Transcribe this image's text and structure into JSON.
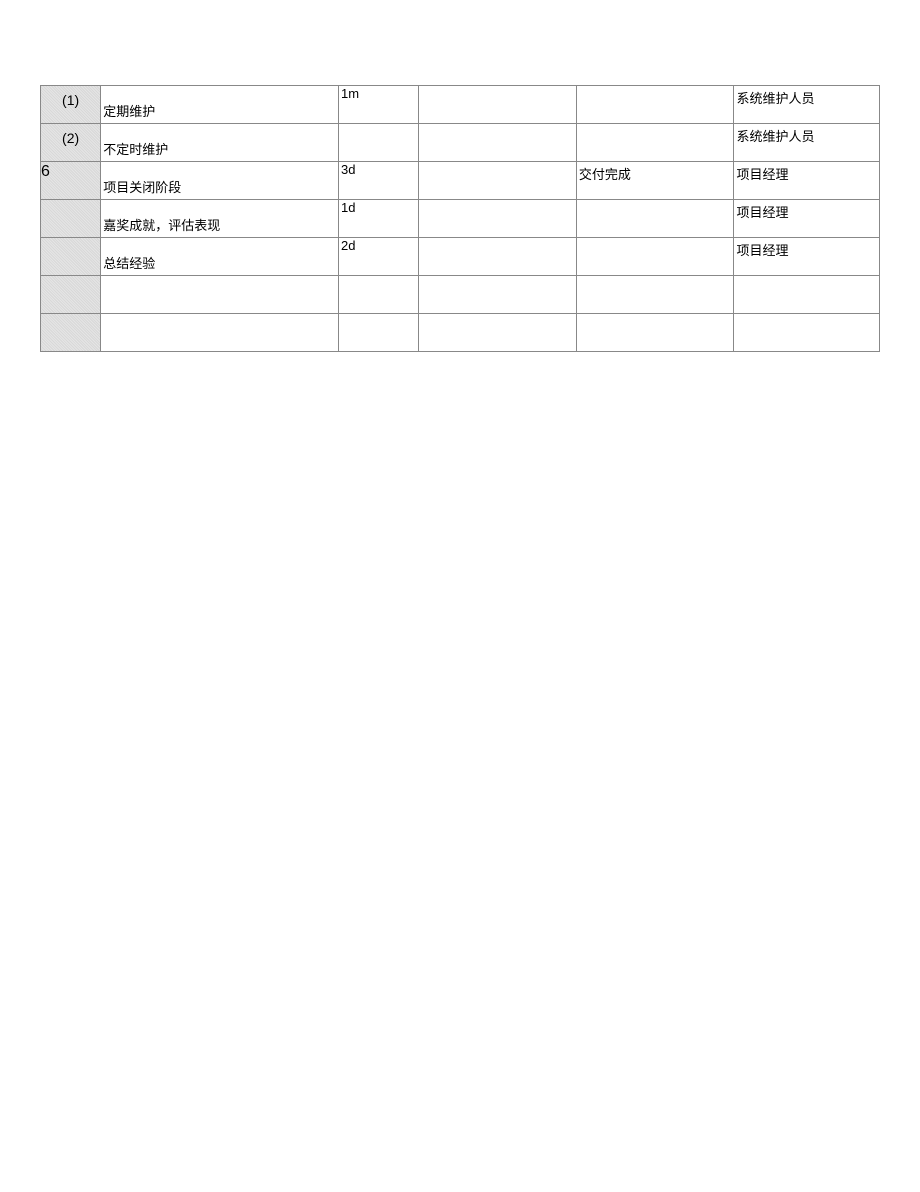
{
  "table": {
    "rows": [
      {
        "index": "(1)",
        "index_class": "idx-cell",
        "task": "定期维护",
        "duration": "1m",
        "col4": "",
        "col5": "",
        "owner": "系统维护人员"
      },
      {
        "index": "(2)",
        "index_class": "idx-cell",
        "task": "不定时维护",
        "duration": "",
        "col4": "",
        "col5": "",
        "owner": "系统维护人员"
      },
      {
        "index": "6",
        "index_class": "idx-cell left-align",
        "task": "项目关闭阶段",
        "duration": "3d",
        "col4": "",
        "col5": "交付完成",
        "owner": "项目经理"
      },
      {
        "index": "",
        "index_class": "idx-cell",
        "task": "嘉奖成就，评估表现",
        "duration": "1d",
        "col4": "",
        "col5": "",
        "owner": "项目经理"
      },
      {
        "index": "",
        "index_class": "idx-cell",
        "task": "总结经验",
        "duration": "2d",
        "col4": "",
        "col5": "",
        "owner": "项目经理"
      },
      {
        "index": "",
        "index_class": "idx-cell",
        "task": "",
        "duration": "",
        "col4": "",
        "col5": "",
        "owner": ""
      },
      {
        "index": "",
        "index_class": "idx-cell",
        "task": "",
        "duration": "",
        "col4": "",
        "col5": "",
        "owner": ""
      }
    ]
  }
}
